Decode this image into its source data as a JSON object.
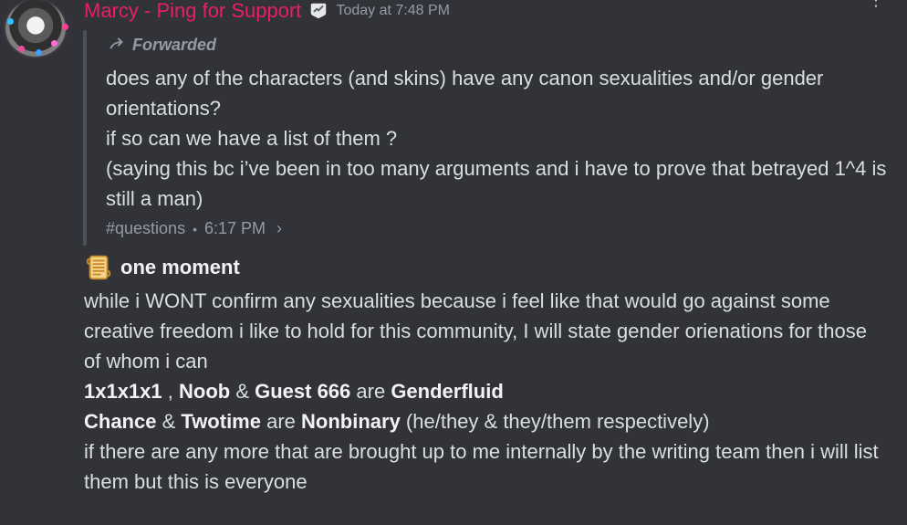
{
  "message": {
    "username": "Marcy - Ping for Support",
    "username_color": "#e91e63",
    "timestamp": "Today at 7:48 PM",
    "badge_icon": "badge-icon",
    "forwarded": {
      "label": "Forwarded",
      "text_lines": [
        "does any of the characters (and skins) have any canon sexualities and/or gender orientations?",
        "if so can we have a list of them ?",
        "(saying this bc i’ve been in too many arguments and i have to prove that betrayed 1^4 is still a man)"
      ],
      "channel": "#questions",
      "separator": "•",
      "time": "6:17 PM",
      "chevron": "›"
    },
    "reply": {
      "subheading": "one moment",
      "paragraph_1": "while i WONT confirm any sexualities because i feel like that would go against some creative freedom i like to hold for this community, I will state gender orienations for those of whom i can",
      "line_2": {
        "a": "1x1x1x1",
        "comma": " , ",
        "b": "Noob",
        "amp1": " & ",
        "c": "Guest 666",
        "are": " are ",
        "d": "Genderfluid"
      },
      "line_3": {
        "a": "Chance",
        "amp": " & ",
        "b": "Twotime",
        "are": " are ",
        "c": "Nonbinary",
        "tail": " (he/they & they/them respectively)"
      },
      "paragraph_4": "if there are any more that are brought up to me internally by the writing team then i will list them but this is everyone"
    }
  },
  "colors": {
    "background": "#323339",
    "text": "#dbdee1",
    "muted": "#949ba4",
    "bar": "#4e5058",
    "bold": "#f2f3f5"
  }
}
